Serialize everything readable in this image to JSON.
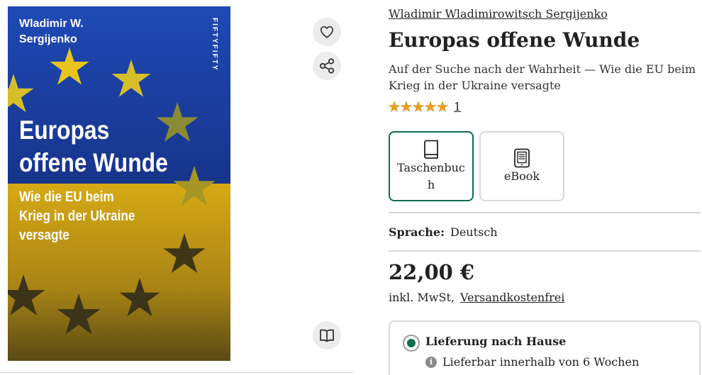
{
  "cover": {
    "author": "Wladimir W.\nSergijenko",
    "publisher": "FIFTYFIFTY",
    "title": "Europas\noffene Wunde",
    "subtitle": "Wie die EU beim\nKrieg in der Ukraine\nversagte",
    "colors": {
      "blue": "#1d3f9a",
      "yellow": "#c79a12",
      "star": "#e8c51d"
    }
  },
  "actions": {
    "favorite_icon": "heart-icon",
    "share_icon": "share-icon",
    "read_icon": "open-book-icon"
  },
  "product": {
    "author": "Wladimir Wladimirowitsch Sergijenko",
    "title": "Europas offene Wunde",
    "subtitle": "Auf der Suche nach der Wahrheit — Wie die EU beim Krieg in der Ukraine versagte",
    "rating": {
      "stars": 5,
      "count": "1",
      "star_color": "#f0a020"
    }
  },
  "formats": [
    {
      "label": "Taschenbuch",
      "icon": "book-icon",
      "selected": true
    },
    {
      "label": "eBook",
      "icon": "ebook-reader-icon",
      "selected": false
    }
  ],
  "language": {
    "key": "Sprache:",
    "value": "Deutsch"
  },
  "price": {
    "amount": "22,00 €",
    "tax_note": "inkl. MwSt,",
    "shipping_link": "Versandkostenfrei"
  },
  "delivery": {
    "option": "Lieferung nach Hause",
    "availability": "Lieferbar innerhalb von 6 Wochen",
    "accent": "#0f6e4a"
  }
}
